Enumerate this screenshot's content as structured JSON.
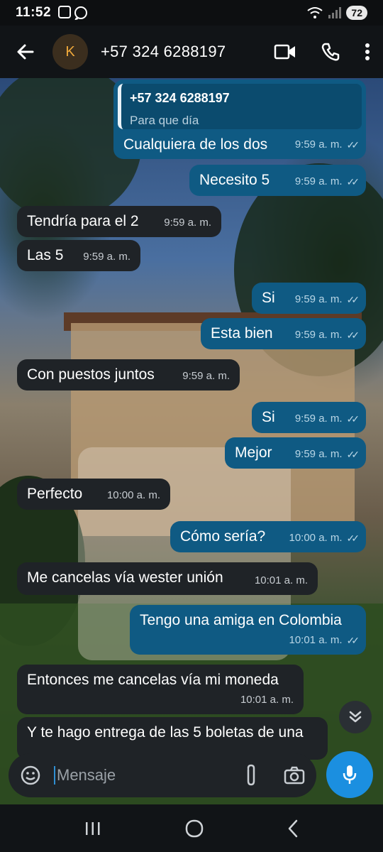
{
  "status_bar": {
    "time": "11:52",
    "battery": "72"
  },
  "header": {
    "avatar_initial": "K",
    "contact": "+57 324 6288197"
  },
  "messages": [
    {
      "dir": "out",
      "quote_name": "+57 324 6288197",
      "quote_text": "Para que día",
      "text": "Cualquiera de los dos",
      "time": "9:59 a. m."
    },
    {
      "dir": "out",
      "text": "Necesito 5",
      "time": "9:59 a. m."
    },
    {
      "dir": "in",
      "text": "Tendría para el 2",
      "time": "9:59 a. m."
    },
    {
      "dir": "in",
      "text": "Las 5",
      "time": "9:59 a. m."
    },
    {
      "dir": "out",
      "text": "Si",
      "time": "9:59 a. m."
    },
    {
      "dir": "out",
      "text": "Esta bien",
      "time": "9:59 a. m."
    },
    {
      "dir": "in",
      "text": "Con puestos juntos",
      "time": "9:59 a. m."
    },
    {
      "dir": "out",
      "text": "Si",
      "time": "9:59 a. m."
    },
    {
      "dir": "out",
      "text": "Mejor",
      "time": "9:59 a. m."
    },
    {
      "dir": "in",
      "text": "Perfecto",
      "time": "10:00 a. m."
    },
    {
      "dir": "out",
      "text": "Cómo sería?",
      "time": "10:00 a. m."
    },
    {
      "dir": "in",
      "text": "Me cancelas vía wester unión",
      "time": "10:01 a. m."
    },
    {
      "dir": "out",
      "text": "Tengo una amiga en Colombia",
      "time": "10:01 a. m."
    },
    {
      "dir": "in",
      "text": "Entonces me cancelas vía mi moneda",
      "time": "10:01 a. m."
    },
    {
      "dir": "in",
      "text": "Y te hago entrega de las 5 boletas de una"
    }
  ],
  "composer": {
    "placeholder": "Mensaje"
  }
}
